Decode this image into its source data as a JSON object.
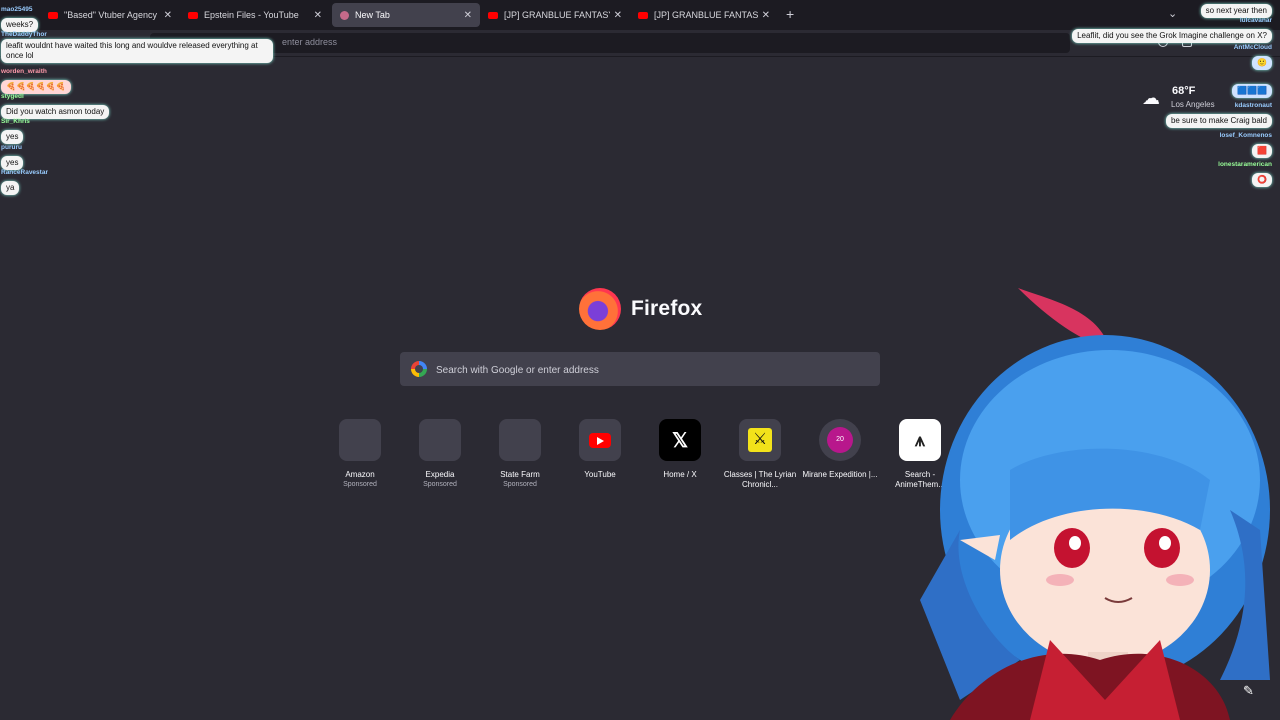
{
  "tabs": [
    {
      "title": "\"Based\" Vtuber Agency Bends K",
      "icon": "youtube"
    },
    {
      "title": "Epstein Files - YouTube",
      "icon": "youtube"
    },
    {
      "title": "New Tab",
      "icon": "firefox",
      "active": true
    },
    {
      "title": "[JP] GRANBLUE FANTASY: Relink",
      "icon": "youtube"
    },
    {
      "title": "[JP] GRANBLUE FANTASY: Relink",
      "icon": "youtube"
    }
  ],
  "toolbar": {
    "urlbar_text": "enter address"
  },
  "brand": {
    "name": "Firefox"
  },
  "search": {
    "placeholder": "Search with Google or enter address"
  },
  "shortcuts": [
    {
      "name": "Amazon",
      "sub": "Sponsored"
    },
    {
      "name": "Expedia",
      "sub": "Sponsored"
    },
    {
      "name": "State Farm",
      "sub": "Sponsored"
    },
    {
      "name": "YouTube",
      "sub": ""
    },
    {
      "name": "Home / X",
      "sub": ""
    },
    {
      "name": "Classes | The Lyrian Chronicl...",
      "sub": ""
    },
    {
      "name": "Mirane Expedition |...",
      "sub": "",
      "badge": "20"
    },
    {
      "name": "Search - AnimeThem...",
      "sub": ""
    }
  ],
  "weather": {
    "temp": "68°F",
    "city": "Los Angeles",
    "icon": "cloud-sun-icon"
  },
  "chat_left": [
    {
      "user": "mao25495",
      "msg": "weeks?"
    },
    {
      "user": "TheDaddyThor",
      "msg": "leafit wouldnt have waited this long and wouldve released everything at once lol"
    },
    {
      "user": "worden_wraith",
      "msg": "🍕🍕🍕🍕🍕🍕"
    },
    {
      "user": "stygedl",
      "msg": "Did you watch asmon today"
    },
    {
      "user": "Sir_Khris",
      "msg": "yes"
    },
    {
      "user": "pururu",
      "msg": "yes"
    },
    {
      "user": "RanceRavestar",
      "msg": "ya"
    }
  ],
  "chat_right": [
    {
      "user": "",
      "msg": "so next year then"
    },
    {
      "user": "lulcavanar",
      "msg": "Leaflit, did you see the Grok Imagine challenge on X?"
    },
    {
      "user": "AntMcCloud",
      "msg": ""
    },
    {
      "user": "",
      "msg": ""
    },
    {
      "user": "kdastronaut",
      "msg": "be sure to make Craig bald"
    },
    {
      "user": "losef_Komnenos",
      "msg": ""
    },
    {
      "user": "lonestaramerican",
      "msg": ""
    }
  ]
}
